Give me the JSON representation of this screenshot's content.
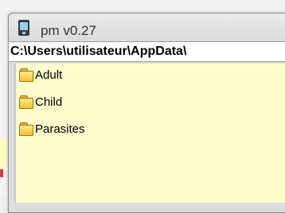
{
  "window": {
    "title": "pm v0.27"
  },
  "path": {
    "value": "C:\\Users\\utilisateur\\AppData\\"
  },
  "tree": {
    "items": [
      {
        "label": "Adult",
        "icon": "folder-icon"
      },
      {
        "label": "Child",
        "icon": "folder-icon"
      },
      {
        "label": "Parasites",
        "icon": "folder-icon"
      }
    ]
  },
  "colors": {
    "tree_background": "#fffbcc",
    "folder": "#f2c233"
  }
}
